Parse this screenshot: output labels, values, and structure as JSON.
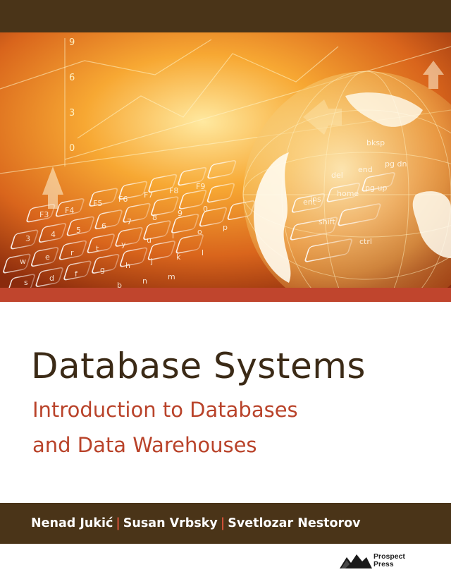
{
  "cover": {
    "title": "Database Systems",
    "subtitle_line1": "Introduction to Databases",
    "subtitle_line2": "and Data Warehouses"
  },
  "authors": {
    "author1": "Nenad Jukić",
    "author2": "Susan Vrbsky",
    "author3": "Svetlozar Nestorov",
    "separator": "|"
  },
  "publisher": {
    "line1": "Prospect",
    "line2": "Press"
  },
  "illustration": {
    "axis_numbers": [
      "9",
      "6",
      "3",
      "0"
    ],
    "keys_row1": [
      "F3",
      "F4",
      "F5",
      "F6",
      "F7",
      "F8",
      "F9"
    ],
    "keys_row2": [
      "3",
      "4",
      "5",
      "6",
      "7",
      "8",
      "9",
      "0"
    ],
    "keys_row3": [
      "w",
      "e",
      "r",
      "t",
      "y",
      "u",
      "i",
      "o",
      "p"
    ],
    "keys_row4": [
      "s",
      "d",
      "f",
      "g",
      "h",
      "j",
      "k",
      "l"
    ],
    "keys_row5": [
      "x",
      "c",
      "v",
      "b",
      "n",
      "m"
    ],
    "keys_special": [
      "ins",
      "home",
      "pg up",
      "del",
      "end",
      "pg dn",
      "bksp",
      "shift",
      "ent",
      "ctrl"
    ]
  },
  "colors": {
    "dark_brown": "#4a3418",
    "accent_red": "#c0452d",
    "subtitle_red": "#b9432a",
    "title_brown": "#3b2a16"
  }
}
